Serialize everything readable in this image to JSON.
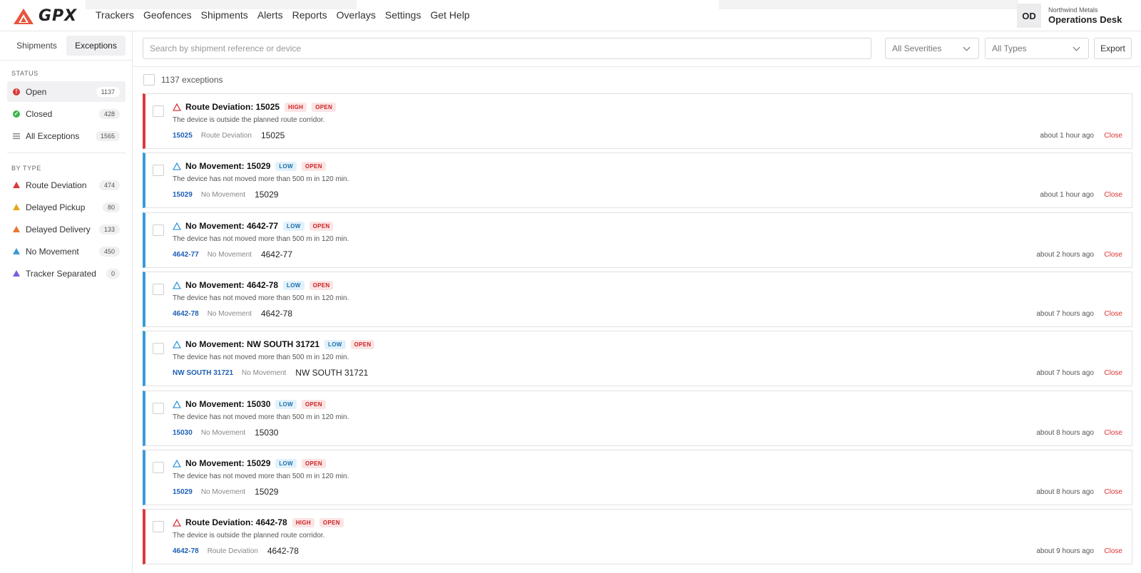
{
  "brand": {
    "name": "GPX"
  },
  "nav": [
    "Trackers",
    "Geofences",
    "Shipments",
    "Alerts",
    "Reports",
    "Overlays",
    "Settings",
    "Get Help"
  ],
  "account": {
    "initials": "OD",
    "org": "Northwind Metals",
    "name": "Operations Desk"
  },
  "sidebar": {
    "tabs": [
      {
        "label": "Shipments",
        "active": false
      },
      {
        "label": "Exceptions",
        "active": true
      }
    ],
    "status_heading": "STATUS",
    "status_items": [
      {
        "label": "Open",
        "count": "1137",
        "icon": "alert-circle-icon",
        "color": "#d93a3a",
        "active": true
      },
      {
        "label": "Closed",
        "count": "428",
        "icon": "check-circle-icon",
        "color": "#3cb44b",
        "active": false
      },
      {
        "label": "All Exceptions",
        "count": "1565",
        "icon": "list-icon",
        "color": "#888888",
        "active": false
      }
    ],
    "type_heading": "BY TYPE",
    "type_items": [
      {
        "label": "Route Deviation",
        "count": "474",
        "color": "#d93a3a"
      },
      {
        "label": "Delayed Pickup",
        "count": "80",
        "color": "#e6a817"
      },
      {
        "label": "Delayed Delivery",
        "count": "133",
        "color": "#e8772e"
      },
      {
        "label": "No Movement",
        "count": "450",
        "color": "#3a9ad9"
      },
      {
        "label": "Tracker Separated",
        "count": "0",
        "color": "#7b5be0"
      }
    ]
  },
  "toolbar": {
    "search_placeholder": "Search by shipment reference or device",
    "severity_filter": "All Severities",
    "type_filter": "All Types",
    "export_label": "Export"
  },
  "summary": {
    "count_text": "1137 exceptions"
  },
  "exceptions": [
    {
      "title": "Route Deviation: 15025",
      "severity": "HIGH",
      "status": "OPEN",
      "description": "The device is outside the planned route corridor.",
      "ref": "15025",
      "type": "Route Deviation",
      "device": "15025",
      "time": "about 1 hour ago",
      "close": "Close",
      "color": "#d93a3a"
    },
    {
      "title": "No Movement: 15029",
      "severity": "LOW",
      "status": "OPEN",
      "description": "The device has not moved more than 500 m in 120 min.",
      "ref": "15029",
      "type": "No Movement",
      "device": "15029",
      "time": "about 1 hour ago",
      "close": "Close",
      "color": "#3a9ad9"
    },
    {
      "title": "No Movement: 4642-77",
      "severity": "LOW",
      "status": "OPEN",
      "description": "The device has not moved more than 500 m in 120 min.",
      "ref": "4642-77",
      "type": "No Movement",
      "device": "4642-77",
      "time": "about 2 hours ago",
      "close": "Close",
      "color": "#3a9ad9"
    },
    {
      "title": "No Movement: 4642-78",
      "severity": "LOW",
      "status": "OPEN",
      "description": "The device has not moved more than 500 m in 120 min.",
      "ref": "4642-78",
      "type": "No Movement",
      "device": "4642-78",
      "time": "about 7 hours ago",
      "close": "Close",
      "color": "#3a9ad9"
    },
    {
      "title": "No Movement: NW SOUTH 31721",
      "severity": "LOW",
      "status": "OPEN",
      "description": "The device has not moved more than 500 m in 120 min.",
      "ref": "NW SOUTH 31721",
      "type": "No Movement",
      "device": "NW SOUTH 31721",
      "time": "about 7 hours ago",
      "close": "Close",
      "color": "#3a9ad9"
    },
    {
      "title": "No Movement: 15030",
      "severity": "LOW",
      "status": "OPEN",
      "description": "The device has not moved more than 500 m in 120 min.",
      "ref": "15030",
      "type": "No Movement",
      "device": "15030",
      "time": "about 8 hours ago",
      "close": "Close",
      "color": "#3a9ad9"
    },
    {
      "title": "No Movement: 15029",
      "severity": "LOW",
      "status": "OPEN",
      "description": "The device has not moved more than 500 m in 120 min.",
      "ref": "15029",
      "type": "No Movement",
      "device": "15029",
      "time": "about 8 hours ago",
      "close": "Close",
      "color": "#3a9ad9"
    },
    {
      "title": "Route Deviation: 4642-78",
      "severity": "HIGH",
      "status": "OPEN",
      "description": "The device is outside the planned route corridor.",
      "ref": "4642-78",
      "type": "Route Deviation",
      "device": "4642-78",
      "time": "about 9 hours ago",
      "close": "Close",
      "color": "#d93a3a"
    }
  ]
}
